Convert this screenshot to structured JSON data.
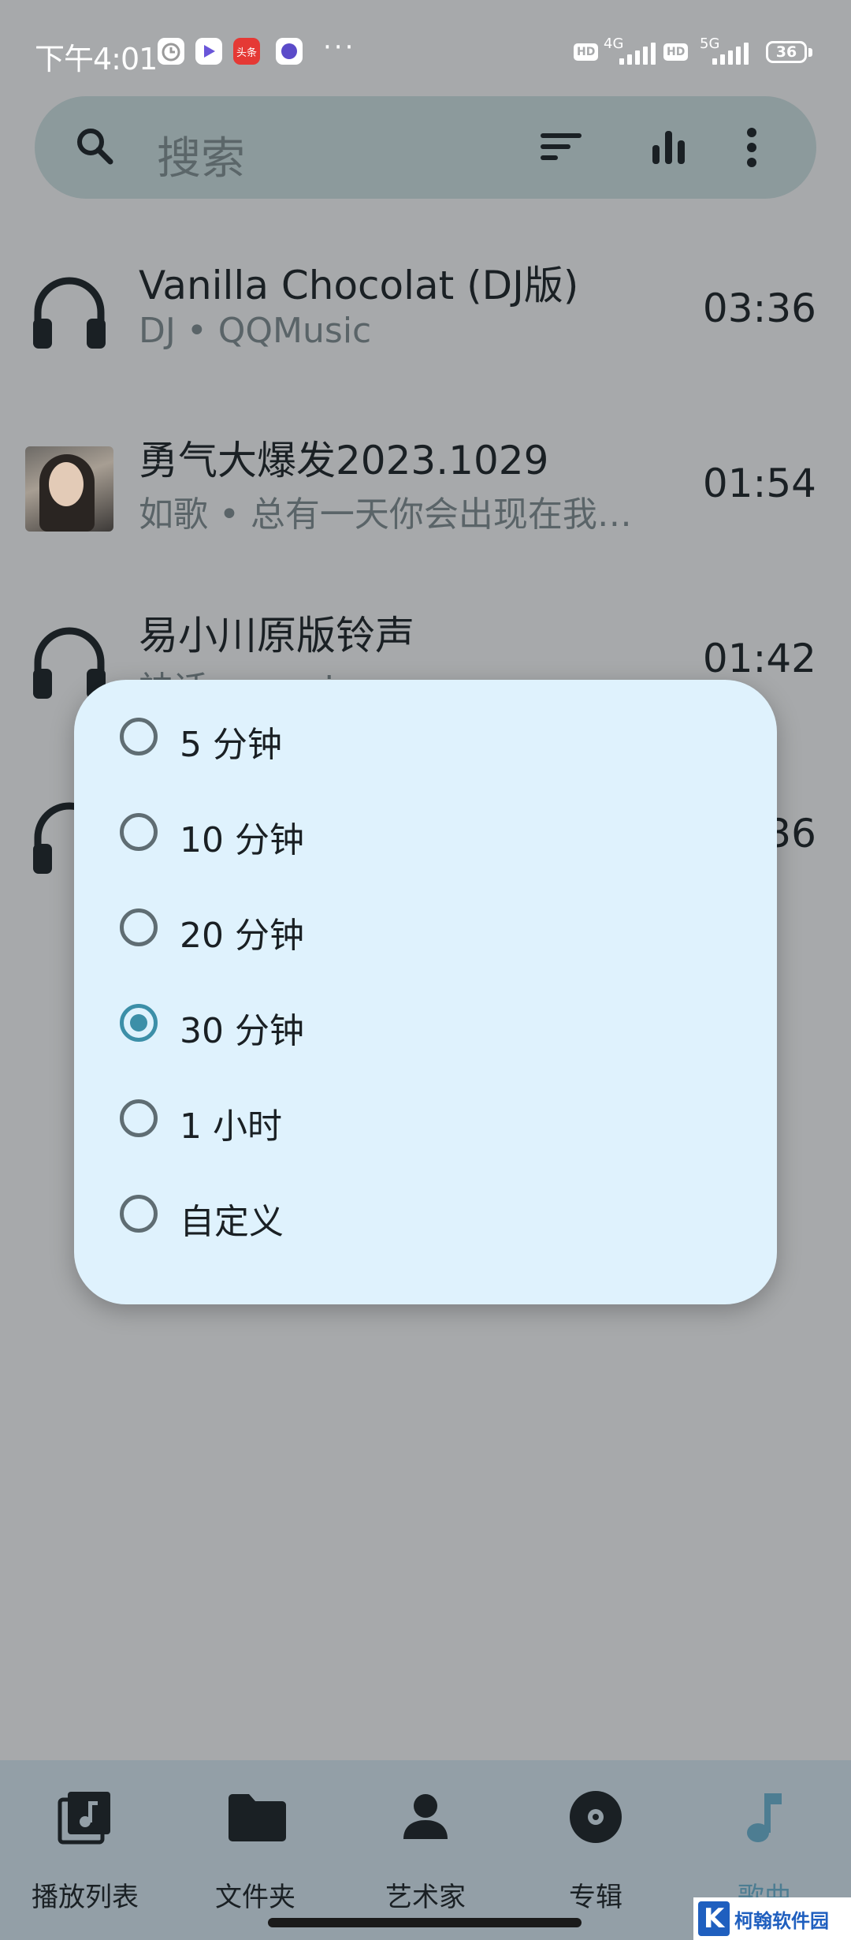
{
  "status_bar": {
    "time": "下午4:01",
    "notif_icons": [
      "alarm-icon",
      "video-app-icon",
      "toutiao-icon",
      "app-icon"
    ],
    "notif_toutiao_text": "头条",
    "overflow": "···",
    "hd1": "HD",
    "net1": "4G",
    "hd2": "HD",
    "net2": "5G",
    "battery": "36"
  },
  "search": {
    "placeholder": "搜索"
  },
  "songs": [
    {
      "title": "Vanilla Chocolat (DJ版)",
      "subtitle": "DJ  •  QQMusic",
      "duration": "03:36",
      "art": "headphones-icon"
    },
    {
      "title": "勇气大爆发2023.1029",
      "subtitle": "如歌  •  总有一天你会出现在我…",
      "duration": "01:54",
      "art": "album-cover"
    },
    {
      "title": "易小川原版铃声",
      "subtitle": "神话  •  music",
      "duration": "01:42",
      "art": "headphones-icon"
    },
    {
      "title": "",
      "subtitle": "",
      "duration": "03:36",
      "art": "headphones-icon"
    }
  ],
  "sleep_timer_dialog": {
    "options": [
      {
        "label": "5 分钟",
        "selected": false
      },
      {
        "label": "10 分钟",
        "selected": false
      },
      {
        "label": "20 分钟",
        "selected": false
      },
      {
        "label": "30 分钟",
        "selected": true
      },
      {
        "label": "1 小时",
        "selected": false
      },
      {
        "label": "自定义",
        "selected": false
      }
    ]
  },
  "bottom_nav": {
    "items": [
      {
        "label": "播放列表",
        "icon": "playlist-icon",
        "active": false
      },
      {
        "label": "文件夹",
        "icon": "folder-icon",
        "active": false
      },
      {
        "label": "艺术家",
        "icon": "artist-icon",
        "active": false
      },
      {
        "label": "专辑",
        "icon": "album-icon",
        "active": false
      },
      {
        "label": "歌曲",
        "icon": "music-note-icon",
        "active": true
      }
    ]
  },
  "watermark": {
    "logo_letter": "K",
    "text": "柯翰软件园"
  },
  "colors": {
    "scrim_background": "#a7a9ab",
    "dialog_background": "#dff2fd",
    "accent": "#3c8fa8",
    "nav_background": "#939fa7"
  }
}
